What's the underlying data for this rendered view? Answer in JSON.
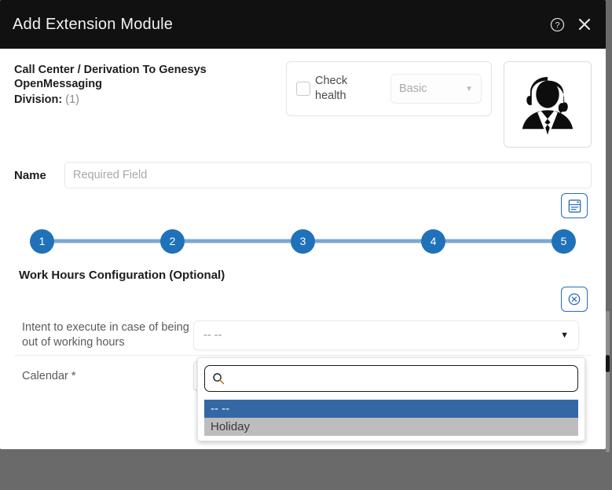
{
  "window": {
    "title": "Add Extension Module",
    "help_icon": "help-circle-icon",
    "close_icon": "close-icon"
  },
  "summary": {
    "entity_path": "Call Center / Derivation To Genesys OpenMessaging",
    "division_label": "Division:",
    "division_value": "(1)",
    "health": {
      "checkbox_label": "Check health",
      "checked": false,
      "level_value": "Basic",
      "caret": "▼"
    },
    "avatar_icon": "call-center-agent-avatar-icon"
  },
  "name_field": {
    "label": "Name",
    "value": "",
    "placeholder": "Required Field"
  },
  "toolbar": {
    "form_template_icon": "form-template-icon",
    "remove_icon": "circle-x-icon"
  },
  "stepper": {
    "steps": [
      {
        "number": "1"
      },
      {
        "number": "2"
      },
      {
        "number": "3"
      },
      {
        "number": "4"
      },
      {
        "number": "5"
      }
    ]
  },
  "work_hours": {
    "title": "Work Hours Configuration (Optional)",
    "rows": [
      {
        "label": "Intent to execute in case of being out of working hours",
        "value": "-- --",
        "caret": "▼"
      },
      {
        "label": "Calendar *",
        "value": "-- --",
        "caret": "▼"
      }
    ]
  },
  "calendar_dropdown": {
    "open": true,
    "search_value": "",
    "search_placeholder": "",
    "search_icon": "search-icon",
    "options": [
      {
        "label": "-- --",
        "state": "selected"
      },
      {
        "label": "Holiday",
        "state": "hovered"
      }
    ]
  },
  "colors": {
    "header_bg": "#111111",
    "accent_blue": "#1f72ba",
    "stepper_line": "#7ba8d1",
    "option_selected_bg": "#3468a5",
    "option_hover_bg": "#bdbdbd",
    "page_backdrop": "#6a6a6a"
  }
}
